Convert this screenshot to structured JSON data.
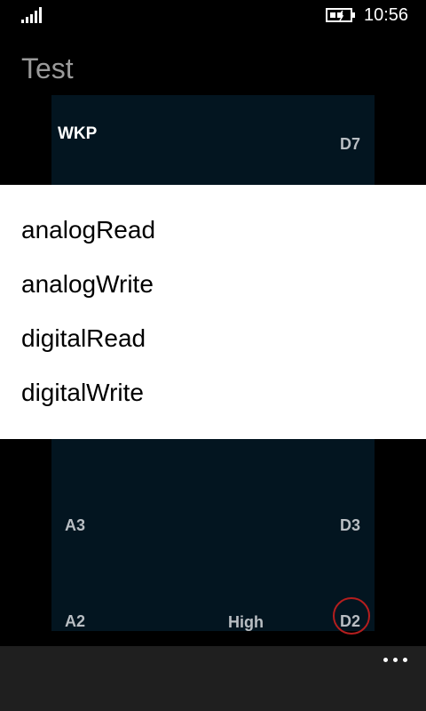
{
  "status_bar": {
    "time": "10:56",
    "signal_icon": "signal-strength-icon",
    "battery_icon": "battery-charging-icon"
  },
  "app": {
    "title": "Test"
  },
  "board": {
    "pins": {
      "wkp": "WKP",
      "d7": "D7",
      "a3": "A3",
      "d3": "D3",
      "a2": "A2",
      "d2": "D2"
    },
    "d2_state": "High",
    "highlight_color": "#b41e1e",
    "panel_color": "#031520"
  },
  "picker": {
    "items": [
      "analogRead",
      "analogWrite",
      "digitalRead",
      "digitalWrite"
    ]
  },
  "app_bar": {
    "more_icon": "ellipsis-icon"
  }
}
